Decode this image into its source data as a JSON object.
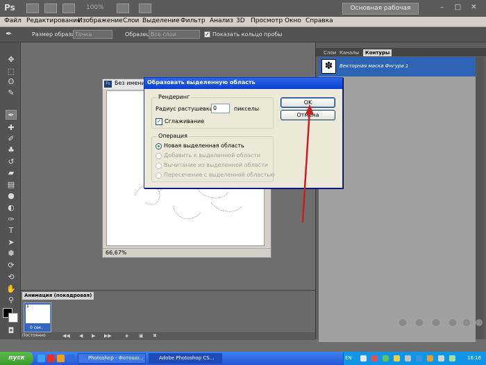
{
  "app": {
    "logo": "Ps",
    "zoom": "100%",
    "workspace": "Основная рабочая среда",
    "window_controls": [
      "–",
      "□",
      "✕"
    ]
  },
  "menu": [
    "Файл",
    "Редактирование",
    "Изображение",
    "Слои",
    "Выделение",
    "Фильтр",
    "Анализ",
    "3D",
    "Просмотр",
    "Окно",
    "Справка"
  ],
  "options": {
    "sample_size_label": "Размер образца:",
    "sample_size_value": "Точка",
    "sample_label": "Образец:",
    "sample_value": "Все слои",
    "show_ring_label": "Показать кольцо пробы",
    "show_ring_checked": true
  },
  "tools": [
    "move-icon",
    "marquee-icon",
    "lasso-icon",
    "quick-select-icon",
    "eyedropper-icon",
    "healing-icon",
    "brush-icon",
    "stamp-icon",
    "history-brush-icon",
    "eraser-icon",
    "gradient-icon",
    "blur-icon",
    "dodge-icon",
    "pen-icon",
    "type-icon",
    "path-select-icon",
    "shape-icon",
    "3d-rotate-icon",
    "3d-orbit-icon",
    "hand-icon",
    "zoom-icon"
  ],
  "document": {
    "title": "Без имени-",
    "zoom": "66,67%"
  },
  "panel": {
    "tabs": [
      "Слои",
      "Каналы",
      "Контуры"
    ],
    "active_tab": "Контуры",
    "path_item": "Векторная маска Фигура 1"
  },
  "animation": {
    "tab": "Анимация (покадровая)",
    "frame_number": "1",
    "frame_delay": "0 сек.",
    "loop": "Постоянно"
  },
  "dialog": {
    "title": "Образовать выделенную область",
    "rendering_group": "Рендеринг",
    "radius_label": "Радиус растушевки:",
    "radius_value": "0",
    "radius_unit": "пикселы",
    "antialias_label": "Сглаживание",
    "antialias_checked": true,
    "operation_group": "Операция",
    "operations": [
      {
        "label": "Новая выделенная область",
        "selected": true,
        "enabled": true
      },
      {
        "label": "Добавить к выделенной области",
        "selected": false,
        "enabled": false
      },
      {
        "label": "Вычитание из выделенной области",
        "selected": false,
        "enabled": false
      },
      {
        "label": "Пересечение с выделенной областью",
        "selected": false,
        "enabled": false
      }
    ],
    "ok_label": "OK",
    "cancel_label": "Отмена"
  },
  "taskbar": {
    "start": "пуск",
    "tasks": [
      "Photoshop - Фотошо...",
      "Adobe Photoshop CS..."
    ],
    "lang": "EN",
    "clock": "16:16"
  },
  "colors": {
    "arrow": "#c81e1e",
    "dialog_title": "#0a3fd0",
    "selection_row": "#2e64b4"
  }
}
